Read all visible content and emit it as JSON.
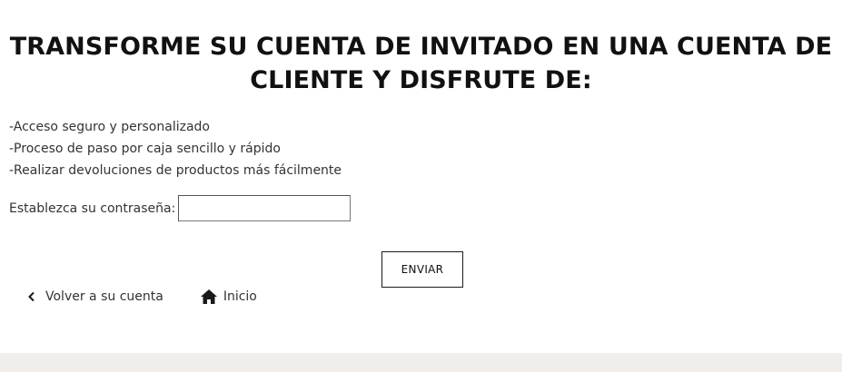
{
  "heading": {
    "line1": "TRANSFORME SU CUENTA DE INVITADO EN UNA CUENTA DE",
    "line2": "CLIENTE Y DISFRUTE DE:"
  },
  "benefits": [
    "-Acceso seguro y personalizado",
    "-Proceso de paso por caja sencillo y rápido",
    "-Realizar devoluciones de productos más fácilmente"
  ],
  "password": {
    "label": "Establezca su contraseña:",
    "value": ""
  },
  "submit_label": "ENVIAR",
  "footer": {
    "back_label": "Volver a su cuenta",
    "back_icon": "chevron-left-icon",
    "home_label": "Inicio",
    "home_icon": "home-icon"
  },
  "colors": {
    "text": "#333333",
    "heading": "#111111",
    "band": "#f0edea"
  }
}
